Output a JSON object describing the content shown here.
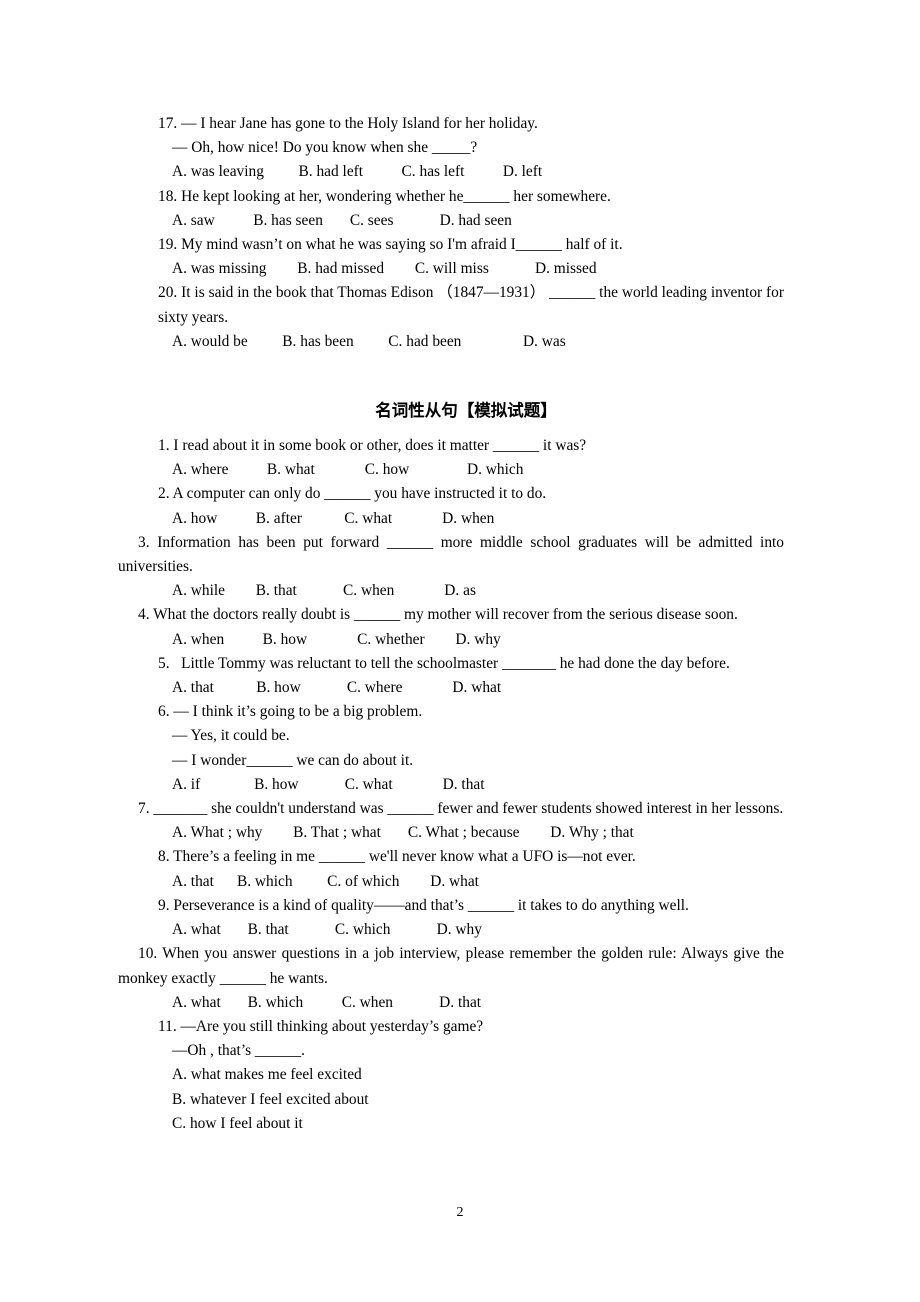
{
  "document": {
    "page_number": "2",
    "section_heading": "名词性从句【模拟试题】"
  },
  "part_one": {
    "questions": [
      {
        "id": "q17",
        "stem": "17. — I hear Jane has gone to the Holy Island for her holiday.",
        "continuation": "— Oh, how nice! Do you know when she _____?",
        "options": "A. was leaving         B. had left          C. has left          D. left"
      },
      {
        "id": "q18",
        "stem": "18. He kept looking at her, wondering whether he______ her somewhere.",
        "options": "A. saw          B. has seen       C. sees            D. had seen"
      },
      {
        "id": "q19",
        "stem": "19. My mind wasn’t on what he was saying so I'm afraid I______ half of it.",
        "options": "A. was missing        B. had missed        C. will miss            D. missed"
      },
      {
        "id": "q20",
        "stem": "20. It is said in the book that Thomas Edison （1847—1931） ______ the world leading inventor for sixty years.",
        "options": "A. would be         B. has been         C. had been                D. was"
      }
    ]
  },
  "part_two": {
    "questions": [
      {
        "id": "q1",
        "stem": "1. I read about it in some book or other, does it matter ______ it was?",
        "options": "A. where          B. what             C. how               D. which"
      },
      {
        "id": "q2",
        "stem": "2. A computer can only do ______ you have instructed it to do.",
        "options": "A. how          B. after           C. what             D. when"
      },
      {
        "id": "q3",
        "stem": "3. Information has been put forward ______ more middle school graduates will be admitted into universities.",
        "options": "A. while        B. that            C. when             D. as"
      },
      {
        "id": "q4",
        "stem": "4. What the doctors really doubt is ______ my mother will recover from the serious disease soon.",
        "options": "A. when          B. how             C. whether        D. why"
      },
      {
        "id": "q5",
        "stem": "5.   Little Tommy was reluctant to tell the schoolmaster _______ he had done the day before.",
        "options": "A. that           B. how            C. where             D. what"
      },
      {
        "id": "q6",
        "stem": "6. — I think it’s going to be a big problem.",
        "continuation_1": "— Yes, it could be.",
        "continuation_2": "— I wonder______ we can do about it.",
        "options": "A. if              B. how            C. what             D. that"
      },
      {
        "id": "q7",
        "stem": "7. _______ she couldn't understand was ______ fewer and fewer students showed interest in her lessons.",
        "options": "A. What ; why        B. That ; what       C. What ; because        D. Why ; that"
      },
      {
        "id": "q8",
        "stem": "8. There’s a feeling in me ______ we'll never know what a UFO is—not ever.",
        "options": "A. that      B. which         C. of which        D. what"
      },
      {
        "id": "q9",
        "stem": "9. Perseverance is a kind of quality——and that’s ______ it takes to do anything well.",
        "options": "A. what       B. that            C. which            D. why"
      },
      {
        "id": "q10",
        "stem": "10. When you answer questions in a job interview, please remember the golden rule: Always give the monkey exactly ______ he wants.",
        "options": "A. what       B. which          C. when            D. that"
      },
      {
        "id": "q11",
        "stem": "11. —Are you still thinking about yesterday’s game?",
        "continuation": "—Oh , that’s ______.",
        "stacked_options": [
          "A. what makes me feel excited",
          "B. whatever I feel excited about",
          "C. how I feel about it"
        ]
      }
    ]
  }
}
